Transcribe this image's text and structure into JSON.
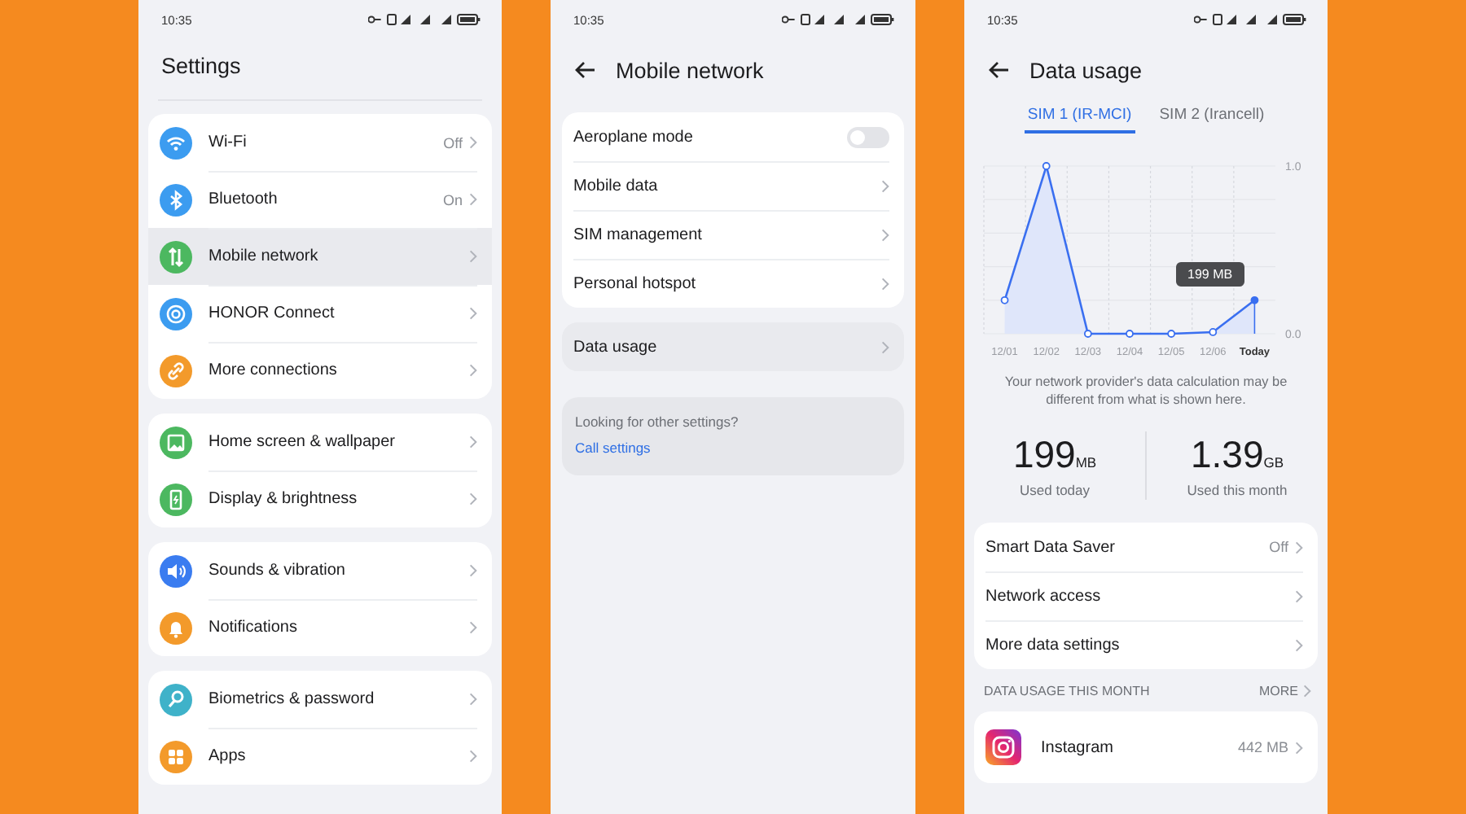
{
  "settings_screen": {
    "status_time": "10:35",
    "title": "Settings",
    "groups": [
      {
        "items": [
          {
            "label": "Wi-Fi",
            "value": "Off",
            "selected": false
          },
          {
            "label": "Bluetooth",
            "value": "On",
            "selected": false
          },
          {
            "label": "Mobile network",
            "selected": true
          },
          {
            "label": "HONOR Connect",
            "selected": false
          },
          {
            "label": "More connections",
            "selected": false
          }
        ]
      },
      {
        "items": [
          {
            "label": "Home screen & wallpaper",
            "selected": false
          },
          {
            "label": "Display & brightness",
            "selected": false
          }
        ]
      },
      {
        "items": [
          {
            "label": "Sounds & vibration",
            "selected": false
          },
          {
            "label": "Notifications",
            "selected": false
          }
        ]
      },
      {
        "items": [
          {
            "label": "Biometrics & password",
            "selected": false
          },
          {
            "label": "Apps",
            "selected": false
          }
        ]
      }
    ]
  },
  "mobile_network_screen": {
    "status_time": "10:35",
    "title": "Mobile network",
    "groups": [
      {
        "items": [
          {
            "kind": "toggle",
            "label": "Aeroplane mode",
            "on": false,
            "selected": false
          },
          {
            "kind": "link",
            "label": "Mobile data",
            "selected": false
          },
          {
            "kind": "link",
            "label": "SIM management",
            "selected": false
          },
          {
            "kind": "link",
            "label": "Personal hotspot",
            "selected": false
          }
        ]
      },
      {
        "items": [
          {
            "kind": "link",
            "label": "Data usage",
            "selected": true
          }
        ]
      }
    ],
    "hint": {
      "text": "Looking for other settings?",
      "link": "Call settings"
    }
  },
  "data_usage_screen": {
    "status_time": "10:35",
    "title": "Data usage",
    "tabs": [
      {
        "label": "SIM 1 (IR-MCI)",
        "selected": true
      },
      {
        "label": "SIM 2 (Irancell)",
        "selected": false
      }
    ],
    "chart_data": {
      "type": "area",
      "marker": true,
      "categories": [
        "12/01",
        "12/02",
        "12/03",
        "12/04",
        "12/05",
        "12/06",
        "Today"
      ],
      "values": [
        0.2,
        1.0,
        0,
        0,
        0,
        0.01,
        0.2
      ],
      "ylim": [
        0,
        1
      ],
      "yticks": [
        {
          "value": 0,
          "label": "0.0"
        },
        {
          "value": 1,
          "label": "1.0"
        }
      ]
    },
    "tooltip": "199 MB",
    "note": "Your network provider's data calculation may be different from what is shown here.",
    "stats": [
      {
        "value": "199",
        "unit": "MB",
        "label": "Used today"
      },
      {
        "value": "1.39",
        "unit": "GB",
        "label": "Used this month"
      }
    ],
    "settings": [
      {
        "label": "Smart Data Saver",
        "value": "Off"
      },
      {
        "label": "Network access"
      },
      {
        "label": "More data settings"
      }
    ],
    "section": {
      "title": "DATA USAGE THIS MONTH",
      "action": "MORE"
    },
    "apps": [
      {
        "name": "Instagram",
        "usage": "442 MB"
      }
    ]
  }
}
